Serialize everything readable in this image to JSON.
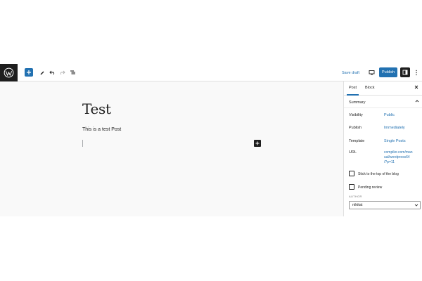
{
  "toolbar": {
    "logo_icon": "wordpress-icon",
    "add_icon": "plus-icon",
    "tools_icon": "pencil-icon",
    "undo_icon": "undo-icon",
    "redo_icon": "redo-icon",
    "outline_icon": "list-view-icon",
    "save_draft_label": "Save draft",
    "preview_icon": "desktop-icon",
    "publish_label": "Publish",
    "settings_icon": "sidebar-icon",
    "options_icon": "more-vertical-icon",
    "accent_color": "#2271b1"
  },
  "editor": {
    "title": "Test",
    "paragraph": "This is a test Post",
    "inserter_icon": "plus-icon"
  },
  "sidebar": {
    "tabs": [
      {
        "label": "Post",
        "active": true
      },
      {
        "label": "Block",
        "active": false
      }
    ],
    "close_icon": "close-icon",
    "summary_label": "Summary",
    "summary_icon": "chevron-up-icon",
    "rows": {
      "visibility": {
        "label": "Visibility",
        "value": "Public"
      },
      "publish": {
        "label": "Publish",
        "value": "Immediately"
      },
      "template": {
        "label": "Template",
        "value": "Single Posts"
      },
      "url": {
        "label": "URL",
        "lines": [
          "compiler.com/man",
          "ual/wordpress64",
          "/?p=11"
        ]
      }
    },
    "sticky": {
      "label": "Stick to the top of the blog",
      "checked": false
    },
    "pending": {
      "label": "Pending review",
      "checked": false
    },
    "author": {
      "label": "AUTHOR",
      "value": "nikitat",
      "icon": "chevron-down-icon"
    }
  }
}
